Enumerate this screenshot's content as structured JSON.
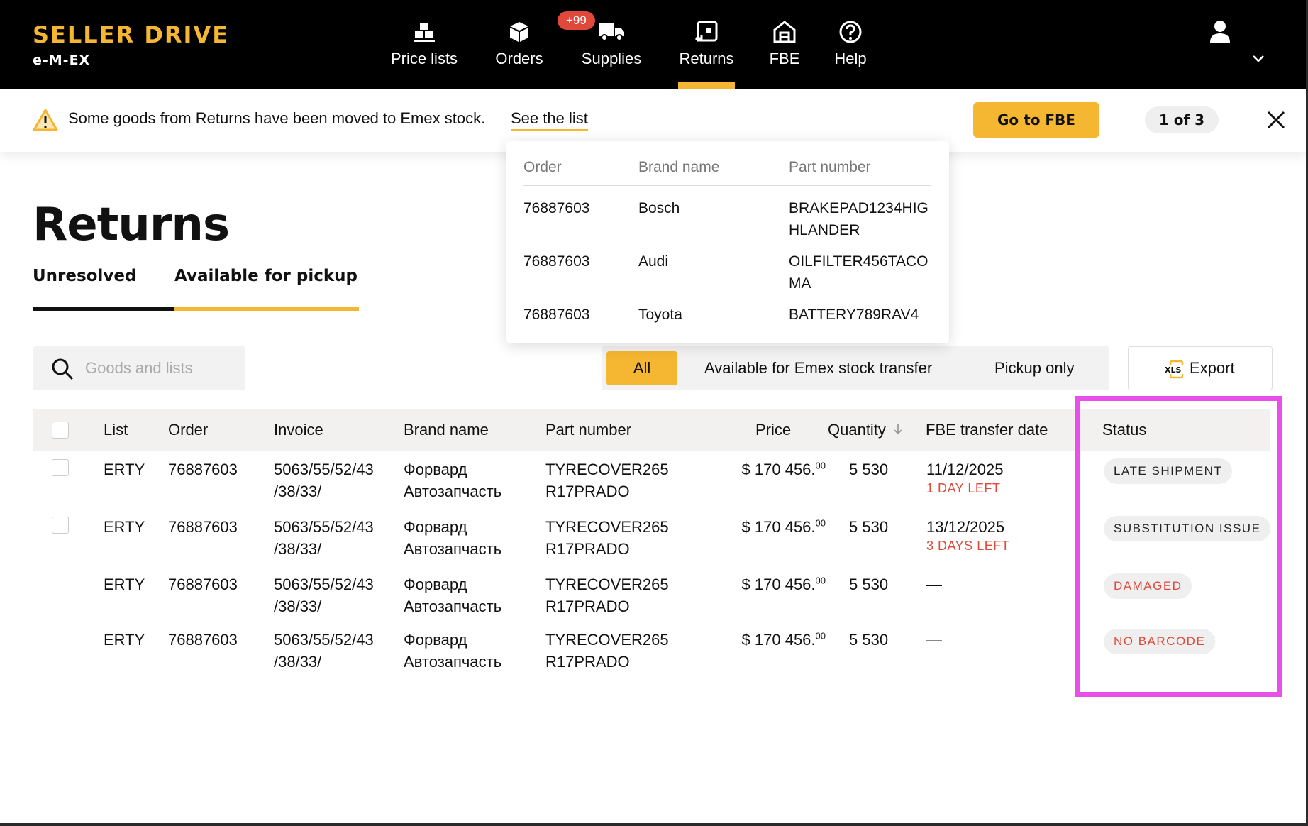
{
  "app": {
    "logo_title": "SELLER DRIVE",
    "logo_sub": "e-M-EX"
  },
  "nav": {
    "items": [
      {
        "label": "Price lists",
        "icon": "price-lists-icon"
      },
      {
        "label": "Orders",
        "icon": "box-icon"
      },
      {
        "label": "Supplies",
        "icon": "truck-icon"
      },
      {
        "label": "Returns",
        "icon": "return-icon",
        "active": true
      },
      {
        "label": "FBE",
        "icon": "warehouse-icon"
      },
      {
        "label": "Help",
        "icon": "help-icon"
      }
    ],
    "supplies_badge": "+99"
  },
  "notice": {
    "text": "Some goods from Returns have been moved to Emex stock.",
    "link": "See the list",
    "button": "Go to FBE",
    "counter": "1 of 3"
  },
  "popover": {
    "headers": [
      "Order",
      "Brand name",
      "Part number"
    ],
    "rows": [
      {
        "order": "76887603",
        "brand": "Bosch",
        "part": "BRAKEPAD1234HIGHLANDER"
      },
      {
        "order": "76887603",
        "brand": "Audi",
        "part": "OILFILTER456TACOMA"
      },
      {
        "order": "76887603",
        "brand": "Toyota",
        "part": "BATTERY789RAV4"
      }
    ]
  },
  "page": {
    "title": "Returns",
    "tabs": [
      "Unresolved",
      "Available for pickup"
    ]
  },
  "search": {
    "placeholder": "Goods and lists"
  },
  "filters": {
    "items": [
      "All",
      "Available for Emex stock transfer",
      "Pickup only"
    ],
    "active": "All"
  },
  "export": {
    "label": "Export",
    "icon_text": "XLS"
  },
  "table": {
    "headers": {
      "list": "List",
      "order": "Order",
      "invoice": "Invoice",
      "brand": "Brand name",
      "part": "Part number",
      "price": "Price",
      "quantity": "Quantity",
      "fbe_date": "FBE transfer date",
      "status": "Status"
    },
    "rows": [
      {
        "checkbox": true,
        "list": "ERTY",
        "order": "76887603",
        "invoice_1": "5063/55/52/43",
        "invoice_2": "/38/33/",
        "brand_1": "Форвард",
        "brand_2": "Автозапчасть",
        "part_1": "TYRECOVER265",
        "part_2": "R17PRADO",
        "price_main": "$ 170 456.",
        "price_cents": "00",
        "quantity": "5 530",
        "date": "11/12/2025",
        "days_left": "1 DAY LEFT",
        "status": "LATE SHIPMENT",
        "status_tone": "neutral"
      },
      {
        "checkbox": true,
        "list": "ERTY",
        "order": "76887603",
        "invoice_1": "5063/55/52/43",
        "invoice_2": "/38/33/",
        "brand_1": "Форвард",
        "brand_2": "Автозапчасть",
        "part_1": "TYRECOVER265",
        "part_2": "R17PRADO",
        "price_main": "$ 170 456.",
        "price_cents": "00",
        "quantity": "5 530",
        "date": "13/12/2025",
        "days_left": "3 DAYS LEFT",
        "status": "SUBSTITUTION ISSUE",
        "status_tone": "neutral"
      },
      {
        "checkbox": false,
        "list": "ERTY",
        "order": "76887603",
        "invoice_1": "5063/55/52/43",
        "invoice_2": "/38/33/",
        "brand_1": "Форвард",
        "brand_2": "Автозапчасть",
        "part_1": "TYRECOVER265",
        "part_2": "R17PRADO",
        "price_main": "$ 170 456.",
        "price_cents": "00",
        "quantity": "5 530",
        "date": "—",
        "days_left": "",
        "status": "DAMAGED",
        "status_tone": "danger"
      },
      {
        "checkbox": false,
        "list": "ERTY",
        "order": "76887603",
        "invoice_1": "5063/55/52/43",
        "invoice_2": "/38/33/",
        "brand_1": "Форвард",
        "brand_2": "Автозапчасть",
        "part_1": "TYRECOVER265",
        "part_2": "R17PRADO",
        "price_main": "$ 170 456.",
        "price_cents": "00",
        "quantity": "5 530",
        "date": "—",
        "days_left": "",
        "status": "NO BARCODE",
        "status_tone": "danger"
      }
    ]
  },
  "colors": {
    "accent": "#f5b731",
    "danger": "#e0483a",
    "highlight": "#e94fe9"
  }
}
